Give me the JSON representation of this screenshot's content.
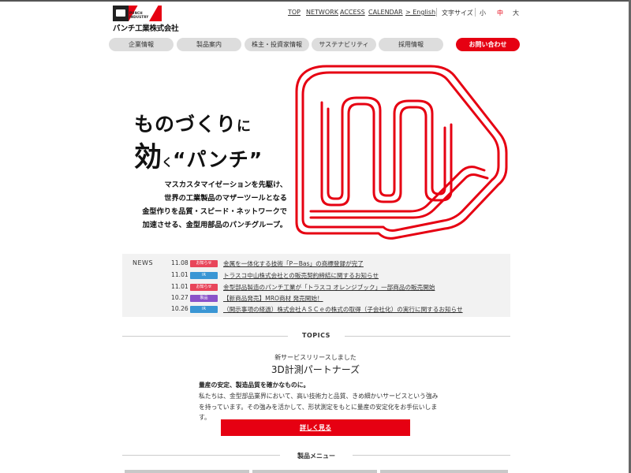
{
  "header": {
    "logo_tag": "PUNCH INDUSTRY",
    "logo_text": "パンチ工業株式会社",
    "brand_color": "#e60012",
    "top_links": [
      "TOP",
      "NETWORK",
      "ACCESS",
      "CALENDAR",
      "> English"
    ],
    "font_size_label": "文字サイズ",
    "font_sizes": [
      "小",
      "中",
      "大"
    ],
    "font_size_selected": "中"
  },
  "menu": {
    "items": [
      "企業情報",
      "製品案内",
      "株主・投資家情報",
      "サステナビリティ",
      "採用情報"
    ],
    "contact": "お問い合わせ"
  },
  "hero": {
    "line1_a": "ものづくり",
    "line1_b": "に",
    "line2_a": "効",
    "line2_b": "く",
    "line2_c": "“パンチ”",
    "desc": [
      "マスカスタマイゼーションを先駆け、",
      "世界の工業製品のマザーツールとなる",
      "金型作りを品質・スピード・ネットワークで",
      "加速させる、金型用部品のパンチグループ。"
    ],
    "graphic_icon": "fist-outline-icon"
  },
  "news": {
    "label": "NEWS",
    "items": [
      {
        "date": "11.08",
        "badge": "お知らせ",
        "badge_color": "#e8455a",
        "title": "金属を一体化する技術「P－Bas」の商標登録が完了"
      },
      {
        "date": "11.01",
        "badge": "IR",
        "badge_color": "#3a96d4",
        "title": "トラスコ中山株式会社との販売契約締結に関するお知らせ"
      },
      {
        "date": "11.01",
        "badge": "お知らせ",
        "badge_color": "#e8455a",
        "title": "金型部品製造のパンチ工業が「トラスコ オレンジブック」一部商品の販売開始"
      },
      {
        "date": "10.27",
        "badge": "製品",
        "badge_color": "#8a52c9",
        "title": "【新商品発売】MRO商材 発売開始！"
      },
      {
        "date": "10.26",
        "badge": "IR",
        "badge_color": "#3a96d4",
        "title": "（開示事項の経過）株式会社ＡＳＣｅの株式の取得（子会社化）の実行に関するお知らせ"
      }
    ]
  },
  "topics": {
    "heading": "TOPICS",
    "sub": "新サービスリリースしました",
    "title": "3D計測パートナーズ",
    "lead": "量産の安定、製造品質を確かなものに。",
    "body": "私たちは、金型部品業界において、高い技術力と品質、きめ細かいサービスという強みを持っています。その強みを活かして、形状測定をもとに量産の安定化をお手伝いします。",
    "button": "詳しく見る"
  },
  "products": {
    "heading": "製品メニュー"
  }
}
